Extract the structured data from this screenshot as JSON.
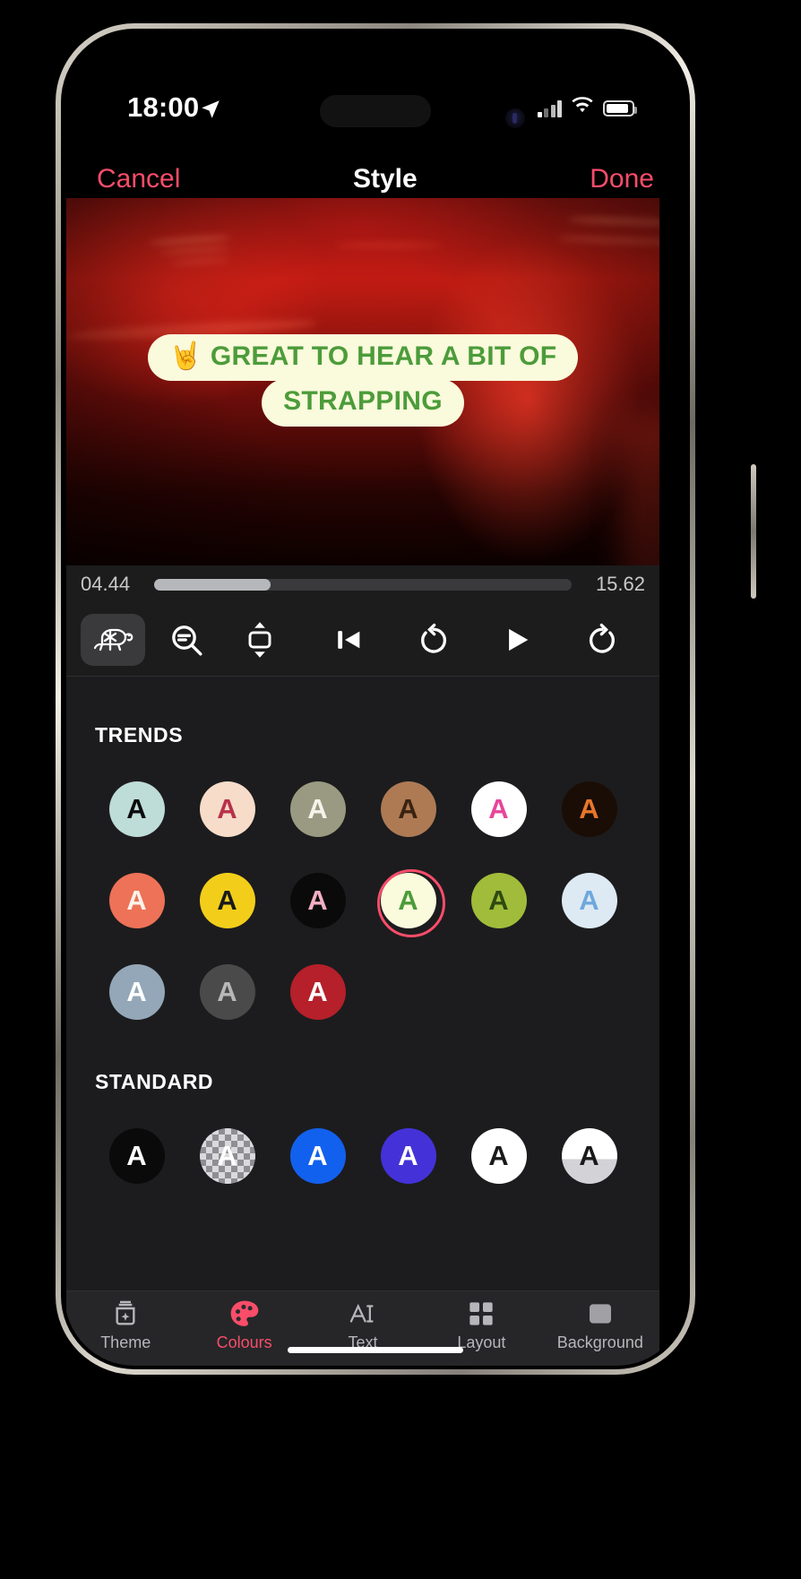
{
  "status_bar": {
    "time": "18:00",
    "location_icon": "location-arrow-icon",
    "cellular_icon": "cellular-bars-icon",
    "wifi_icon": "wifi-icon",
    "battery_icon": "battery-icon"
  },
  "nav": {
    "cancel_label": "Cancel",
    "title": "Style",
    "done_label": "Done",
    "accent_color": "#F94D6A"
  },
  "preview": {
    "caption_lines": [
      "🤘 GREAT TO HEAR A BIT OF",
      "STRAPPING"
    ],
    "caption_text_color": "#4C9C3A",
    "caption_bg_color": "#FAFADC"
  },
  "timeline": {
    "current_time": "04.44",
    "total_time": "15.62",
    "progress_percent": 28
  },
  "controls": {
    "left": [
      {
        "name": "slow-motion-turtle-icon",
        "active": true
      },
      {
        "name": "zoom-out-icon",
        "active": false
      },
      {
        "name": "fit-resize-icon",
        "active": false
      }
    ],
    "right": [
      {
        "name": "skip-to-start-icon"
      },
      {
        "name": "rewind-loop-icon"
      },
      {
        "name": "play-icon"
      },
      {
        "name": "forward-loop-icon"
      }
    ]
  },
  "styles": {
    "sections": [
      {
        "title": "TRENDS",
        "swatches": [
          {
            "bg": "#BEDCD8",
            "fg": "#0A0A0A",
            "letter": "A",
            "selected": false
          },
          {
            "bg": "#F6DCC9",
            "fg": "#B8314A",
            "letter": "A",
            "selected": false
          },
          {
            "bg": "#9A9A82",
            "fg": "#F4F4EC",
            "letter": "A",
            "selected": false
          },
          {
            "bg": "#AE7A54",
            "fg": "#3B2310",
            "letter": "A",
            "selected": false
          },
          {
            "bg": "#FFFFFF",
            "fg": "#E8459A",
            "letter": "A",
            "selected": false
          },
          {
            "bg": "#1A0D06",
            "fg": "#E8762B",
            "letter": "A",
            "selected": false
          },
          {
            "bg": "#EE7257",
            "fg": "#FBF3EA",
            "letter": "A",
            "selected": false
          },
          {
            "bg": "#F2CE1B",
            "fg": "#1A1A1A",
            "letter": "A",
            "selected": false
          },
          {
            "bg": "#0A0A0A",
            "fg": "#F3AFC3",
            "letter": "A",
            "selected": false
          },
          {
            "bg": "#FAFADC",
            "fg": "#4C9C3A",
            "letter": "A",
            "selected": true
          },
          {
            "bg": "#A0BC3A",
            "fg": "#2F4A10",
            "letter": "A",
            "selected": false
          },
          {
            "bg": "#DDEAF4",
            "fg": "#6FA8DC",
            "letter": "A",
            "selected": false
          },
          {
            "bg": "#93A7B8",
            "fg": "#FFFFFF",
            "letter": "A",
            "selected": false
          },
          {
            "bg": "#4A4A4A",
            "fg": "#B8B8B8",
            "letter": "A",
            "selected": false
          },
          {
            "bg": "#B5202A",
            "fg": "#FFFFFF",
            "letter": "A",
            "selected": false
          }
        ]
      },
      {
        "title": "STANDARD",
        "swatches": [
          {
            "bg": "#0A0A0A",
            "fg": "#FFFFFF",
            "letter": "A",
            "selected": false
          },
          {
            "bg": "checker",
            "fg": "#FFFFFF",
            "letter": "A",
            "selected": false
          },
          {
            "bg": "#1261EE",
            "fg": "#FFFFFF",
            "letter": "A",
            "selected": false
          },
          {
            "bg": "#4432D8",
            "fg": "#FFFFFF",
            "letter": "A",
            "selected": false
          },
          {
            "bg": "#FFFFFF",
            "fg": "#1A1A1A",
            "letter": "A",
            "selected": false
          },
          {
            "bg": "halfwhite",
            "fg": "#1A1A1A",
            "letter": "A",
            "selected": false
          }
        ]
      }
    ]
  },
  "tabs": [
    {
      "label": "Theme",
      "icon": "theme-sparkle-icon",
      "active": false
    },
    {
      "label": "Colours",
      "icon": "palette-icon",
      "active": true
    },
    {
      "label": "Text",
      "icon": "text-cursor-icon",
      "active": false
    },
    {
      "label": "Layout",
      "icon": "grid-layout-icon",
      "active": false
    },
    {
      "label": "Background",
      "icon": "background-square-icon",
      "active": false
    }
  ]
}
